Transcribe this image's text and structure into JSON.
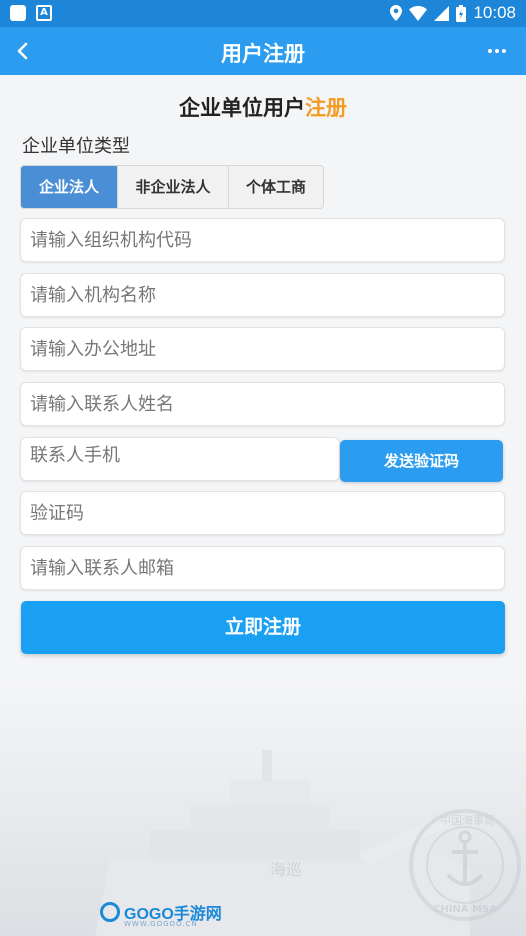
{
  "status_bar": {
    "time": "10:08"
  },
  "app_bar": {
    "back_icon": "‹",
    "title": "用户注册"
  },
  "heading": {
    "main": "企业单位用户",
    "accent": "注册",
    "accent_color": "#f59a23"
  },
  "unit_type": {
    "label": "企业单位类型",
    "options": [
      "企业法人",
      "非企业法人",
      "个体工商"
    ],
    "selected": "企业法人"
  },
  "form": {
    "org_code_placeholder": "请输入组织机构代码",
    "org_name_placeholder": "请输入机构名称",
    "office_address_placeholder": "请输入办公地址",
    "contact_name_placeholder": "请输入联系人姓名",
    "contact_phone_placeholder": "联系人手机",
    "send_code_label": "发送验证码",
    "verify_code_placeholder": "验证码",
    "contact_email_placeholder": "请输入联系人邮箱",
    "submit_label": "立即注册"
  },
  "watermark": {
    "brand": "GOGO手游网",
    "site": "WWW.GOGOO.CN",
    "seal_text": "中国海事局",
    "seal_en": "CHINA MSA",
    "ship_text": "海巡"
  },
  "colors": {
    "status_bar": "#1d86d8",
    "app_bar": "#2b9cf0",
    "primary_button": "#1aa0f2",
    "segment_active": "#4a8fd6"
  }
}
